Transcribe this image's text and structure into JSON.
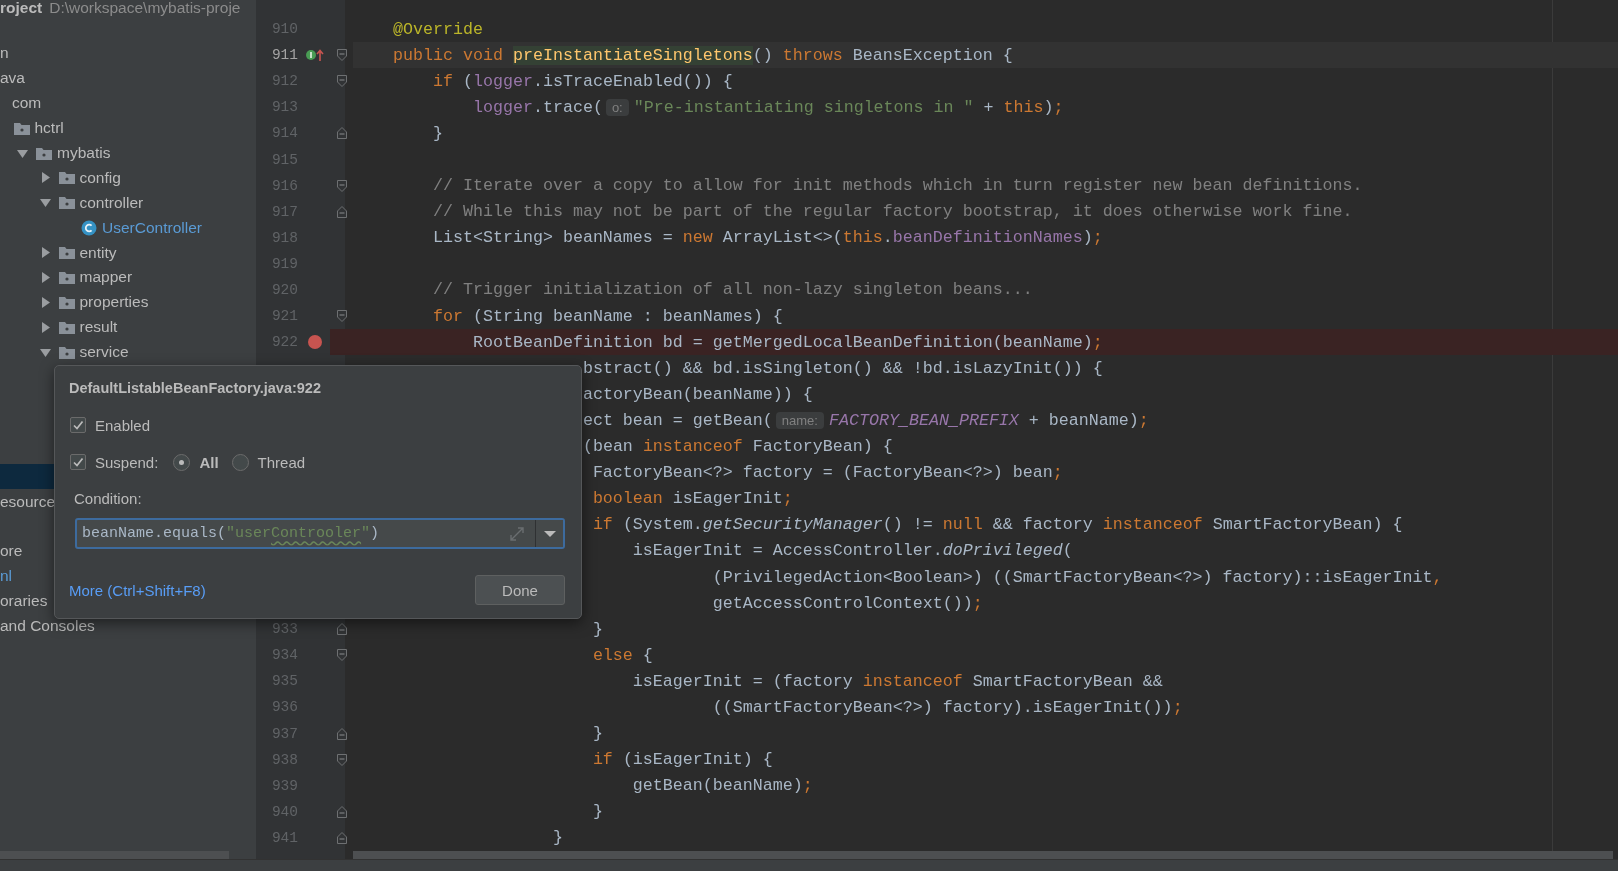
{
  "project": {
    "name": "roject",
    "path": "D:\\workspace\\mybatis-proje"
  },
  "tree": [
    {
      "label": "n",
      "selected": false,
      "modified": false,
      "children": [
        {
          "label": "ava",
          "selected": false,
          "modified": false,
          "children": [
            {
              "label": "com",
              "selected": false,
              "modified": false,
              "children": [
                {
                  "label": "hctrl",
                  "kind": "folder",
                  "selected": false,
                  "modified": false,
                  "children": [
                    {
                      "label": "mybatis",
                      "kind": "folder",
                      "selected": false,
                      "modified": false,
                      "expanded": true,
                      "children": [
                        {
                          "label": "config",
                          "kind": "folder",
                          "selected": false,
                          "modified": false,
                          "expanded": false
                        },
                        {
                          "label": "controller",
                          "kind": "folder",
                          "selected": false,
                          "modified": false,
                          "expanded": true,
                          "children": [
                            {
                              "label": "UserController",
                              "kind": "class",
                              "selected": false,
                              "modified": true
                            }
                          ]
                        },
                        {
                          "label": "entity",
                          "kind": "folder",
                          "selected": false,
                          "modified": false,
                          "expanded": false
                        },
                        {
                          "label": "mapper",
                          "kind": "folder",
                          "selected": false,
                          "modified": false,
                          "expanded": false
                        },
                        {
                          "label": "properties",
                          "kind": "folder",
                          "selected": false,
                          "modified": false,
                          "expanded": false
                        },
                        {
                          "label": "result",
                          "kind": "folder",
                          "selected": false,
                          "modified": false,
                          "expanded": false
                        },
                        {
                          "label": "service",
                          "kind": "folder",
                          "selected": false,
                          "modified": false,
                          "expanded": true
                        }
                      ]
                    }
                  ]
                }
              ]
            }
          ]
        }
      ]
    }
  ],
  "tree_lower": [
    {
      "selected": true
    },
    {
      "label": "esource",
      "selected": false,
      "modified": false
    },
    {
      "label": "ore",
      "selected": false,
      "modified": false
    },
    {
      "label": "nl",
      "selected": false,
      "modified": true
    },
    {
      "label": "oraries",
      "selected": false,
      "modified": false
    },
    {
      "label": "and Consoles",
      "selected": false,
      "modified": false
    }
  ],
  "editor": {
    "lines": [
      {
        "number": "910",
        "current": false,
        "breakpoint": false,
        "code": [
          {
            "text": "    @Override",
            "kind": "annotation"
          }
        ]
      },
      {
        "number": "911",
        "current": true,
        "breakpoint": false,
        "gutter_icon": {
          "kind": "override"
        },
        "fold": {
          "kind": "start"
        },
        "code": [
          {
            "text": "    public void ",
            "kind": "keyword"
          },
          {
            "text": "preInstantiateSingletons",
            "kind": "declaration"
          },
          {
            "text": "() ",
            "kind": "text"
          },
          {
            "text": "throws ",
            "kind": "keyword"
          },
          {
            "text": "BeansException {",
            "kind": "text"
          }
        ]
      },
      {
        "number": "912",
        "current": false,
        "breakpoint": false,
        "fold": {
          "kind": "start"
        },
        "code": [
          {
            "text": "        if ",
            "kind": "keyword"
          },
          {
            "text": "(",
            "kind": "text"
          },
          {
            "text": "logger",
            "kind": "field"
          },
          {
            "text": ".isTraceEnabled()) {",
            "kind": "text"
          }
        ]
      },
      {
        "number": "913",
        "current": false,
        "breakpoint": false,
        "code": [
          {
            "text": "            logger",
            "kind": "field"
          },
          {
            "text": ".trace(",
            "kind": "text"
          },
          {
            "text": "o:",
            "kind": "hint"
          },
          {
            "text": "\"Pre-instantiating singletons in \"",
            "kind": "string"
          },
          {
            "text": " + ",
            "kind": "text"
          },
          {
            "text": "this",
            "kind": "keyword"
          },
          {
            "text": ")",
            "kind": "text"
          },
          {
            "text": ";",
            "kind": "punct"
          }
        ]
      },
      {
        "number": "914",
        "current": false,
        "breakpoint": false,
        "fold": {
          "kind": "end"
        },
        "code": [
          {
            "text": "        }",
            "kind": "text"
          }
        ]
      },
      {
        "number": "915",
        "current": false,
        "breakpoint": false
      },
      {
        "number": "916",
        "current": false,
        "breakpoint": false,
        "fold": {
          "kind": "start"
        },
        "code": [
          {
            "text": "        // Iterate over a copy to allow for init methods which in turn register new bean definitions.",
            "kind": "comment"
          }
        ]
      },
      {
        "number": "917",
        "current": false,
        "breakpoint": false,
        "fold": {
          "kind": "end"
        },
        "code": [
          {
            "text": "        // While this may not be part of the regular factory bootstrap, it does otherwise work fine.",
            "kind": "comment"
          }
        ]
      },
      {
        "number": "918",
        "current": false,
        "breakpoint": false,
        "code": [
          {
            "text": "        List<String> beanNames = ",
            "kind": "text"
          },
          {
            "text": "new ",
            "kind": "keyword"
          },
          {
            "text": "ArrayList<>(",
            "kind": "text"
          },
          {
            "text": "this",
            "kind": "keyword"
          },
          {
            "text": ".",
            "kind": "text"
          },
          {
            "text": "beanDefinitionNames",
            "kind": "field"
          },
          {
            "text": ")",
            "kind": "text"
          },
          {
            "text": ";",
            "kind": "punct"
          }
        ]
      },
      {
        "number": "919",
        "current": false,
        "breakpoint": false
      },
      {
        "number": "920",
        "current": false,
        "breakpoint": false,
        "code": [
          {
            "text": "        // Trigger initialization of all non-lazy singleton beans...",
            "kind": "comment"
          }
        ]
      },
      {
        "number": "921",
        "current": false,
        "breakpoint": false,
        "fold": {
          "kind": "start"
        },
        "code": [
          {
            "text": "        for ",
            "kind": "keyword"
          },
          {
            "text": "(String beanName : beanNames) {",
            "kind": "text"
          }
        ]
      },
      {
        "number": "922",
        "current": false,
        "breakpoint": true,
        "code": [
          {
            "text": "            RootBeanDefinition bd = getMergedLocalBeanDefinition(beanName)",
            "kind": "text"
          },
          {
            "text": ";",
            "kind": "punct"
          }
        ]
      },
      {
        "code": [
          {
            "text": "                       bstract() && bd.isSingleton() && !bd.isLazyInit()) {",
            "kind": "text"
          }
        ]
      },
      {
        "code": [
          {
            "text": "                       actoryBean(beanName)) {",
            "kind": "text"
          }
        ]
      },
      {
        "code": [
          {
            "text": "                       ect bean = getBean(",
            "kind": "text"
          },
          {
            "text": "name:",
            "kind": "hint"
          },
          {
            "text": "FACTORY_BEAN_PREFIX",
            "kind": "constant"
          },
          {
            "text": " + beanName)",
            "kind": "text"
          },
          {
            "text": ";",
            "kind": "punct"
          }
        ]
      },
      {
        "code": [
          {
            "text": "                       (bean ",
            "kind": "text"
          },
          {
            "text": "instanceof ",
            "kind": "keyword"
          },
          {
            "text": "FactoryBean) {",
            "kind": "text"
          }
        ]
      },
      {
        "code": [
          {
            "text": "                        FactoryBean<?> factory = (FactoryBean<?>) bean",
            "kind": "text"
          },
          {
            "text": ";",
            "kind": "punct"
          }
        ]
      },
      {
        "code": [
          {
            "text": "                        boolean ",
            "kind": "keyword"
          },
          {
            "text": "isEagerInit",
            "kind": "text"
          },
          {
            "text": ";",
            "kind": "punct"
          }
        ]
      },
      {
        "code": [
          {
            "text": "                        if ",
            "kind": "keyword"
          },
          {
            "text": "(System.",
            "kind": "text"
          },
          {
            "text": "getSecurityManager",
            "kind": "static-call"
          },
          {
            "text": "() != ",
            "kind": "text"
          },
          {
            "text": "null ",
            "kind": "keyword"
          },
          {
            "text": "&& factory ",
            "kind": "text"
          },
          {
            "text": "instanceof ",
            "kind": "keyword"
          },
          {
            "text": "SmartFactoryBean) {",
            "kind": "text"
          }
        ]
      },
      {
        "code": [
          {
            "text": "                            isEagerInit = AccessController.",
            "kind": "text"
          },
          {
            "text": "doPrivileged",
            "kind": "static-call"
          },
          {
            "text": "(",
            "kind": "text"
          }
        ]
      },
      {
        "code": [
          {
            "text": "                                    (PrivilegedAction<Boolean>) ((SmartFactoryBean<?>) factory)::isEagerInit",
            "kind": "text"
          },
          {
            "text": ",",
            "kind": "punct"
          }
        ]
      },
      {
        "code": [
          {
            "text": "                                    getAccessControlContext())",
            "kind": "text"
          },
          {
            "text": ";",
            "kind": "punct"
          }
        ]
      },
      {
        "number": "933",
        "current": false,
        "breakpoint": false,
        "fold": {
          "kind": "end"
        },
        "code": [
          {
            "text": "                        }",
            "kind": "text"
          }
        ]
      },
      {
        "number": "934",
        "current": false,
        "breakpoint": false,
        "fold": {
          "kind": "start"
        },
        "code": [
          {
            "text": "                        else ",
            "kind": "keyword"
          },
          {
            "text": "{",
            "kind": "text"
          }
        ]
      },
      {
        "number": "935",
        "current": false,
        "breakpoint": false,
        "code": [
          {
            "text": "                            isEagerInit = (factory ",
            "kind": "text"
          },
          {
            "text": "instanceof ",
            "kind": "keyword"
          },
          {
            "text": "SmartFactoryBean &&",
            "kind": "text"
          }
        ]
      },
      {
        "number": "936",
        "current": false,
        "breakpoint": false,
        "code": [
          {
            "text": "                                    ((SmartFactoryBean<?>) factory).isEagerInit())",
            "kind": "text"
          },
          {
            "text": ";",
            "kind": "punct"
          }
        ]
      },
      {
        "number": "937",
        "current": false,
        "breakpoint": false,
        "fold": {
          "kind": "end"
        },
        "code": [
          {
            "text": "                        }",
            "kind": "text"
          }
        ]
      },
      {
        "number": "938",
        "current": false,
        "breakpoint": false,
        "fold": {
          "kind": "start"
        },
        "code": [
          {
            "text": "                        if ",
            "kind": "keyword"
          },
          {
            "text": "(isEagerInit) {",
            "kind": "text"
          }
        ]
      },
      {
        "number": "939",
        "current": false,
        "breakpoint": false,
        "code": [
          {
            "text": "                            getBean(beanName)",
            "kind": "text"
          },
          {
            "text": ";",
            "kind": "punct"
          }
        ]
      },
      {
        "number": "940",
        "current": false,
        "breakpoint": false,
        "fold": {
          "kind": "end"
        },
        "code": [
          {
            "text": "                        }",
            "kind": "text"
          }
        ]
      },
      {
        "number": "941",
        "current": false,
        "breakpoint": false,
        "fold": {
          "kind": "end"
        },
        "code": [
          {
            "text": "                    }",
            "kind": "text"
          }
        ]
      }
    ]
  },
  "breakpoint_popup": {
    "title": "DefaultListableBeanFactory.java:922",
    "enabled": {
      "label": "Enabled",
      "checked": true
    },
    "suspend": {
      "label": "Suspend:",
      "checked": true
    },
    "suspend_options": [
      {
        "label": "All",
        "selected": true
      },
      {
        "label": "Thread",
        "selected": false
      }
    ],
    "condition_label": "Condition:",
    "condition": [
      {
        "text": "beanName.equals(",
        "kind": "text"
      },
      {
        "text": "\"user",
        "kind": "string"
      },
      {
        "text": "Controoler",
        "kind": "string-typo"
      },
      {
        "text": "\"",
        "kind": "string"
      },
      {
        "text": ")",
        "kind": "text"
      }
    ],
    "more_link": "More (Ctrl+Shift+F8)",
    "done_button": "Done"
  }
}
